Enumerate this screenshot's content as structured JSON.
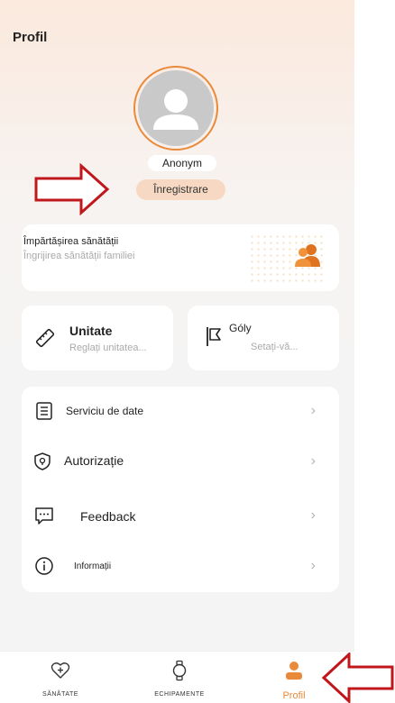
{
  "header": {
    "title": "Profil"
  },
  "profile": {
    "username": "Anonym",
    "register_label": "Înregistrare"
  },
  "share_card": {
    "title": "Împărtășirea sănătății",
    "subtitle": "Îngrijirea sănătății familiei",
    "icon": "family-icon"
  },
  "tiles": {
    "unit": {
      "title": "Unitate",
      "subtitle": "Reglați unitatea...",
      "icon": "ruler-icon"
    },
    "goals": {
      "title": "Góly",
      "subtitle": "Setați-vă...",
      "icon": "flag-icon"
    }
  },
  "menu": {
    "items": [
      {
        "label": "Serviciu de date",
        "icon": "list-icon"
      },
      {
        "label": "Autorizație",
        "icon": "shield-icon"
      },
      {
        "label": "Feedback",
        "icon": "chat-icon"
      },
      {
        "label": "Informații",
        "icon": "info-icon"
      }
    ],
    "chevron": "›"
  },
  "tabbar": {
    "tabs": [
      {
        "label": "SĂNĂTATE",
        "icon": "heart-plus-icon"
      },
      {
        "label": "ECHIPAMENTE",
        "icon": "watch-icon"
      },
      {
        "label": "Profil",
        "icon": "person-icon",
        "active": true
      }
    ]
  },
  "colors": {
    "accent": "#e98a3b",
    "annotation_arrow": "#c0171c",
    "register_bg": "#f7d9c3"
  }
}
